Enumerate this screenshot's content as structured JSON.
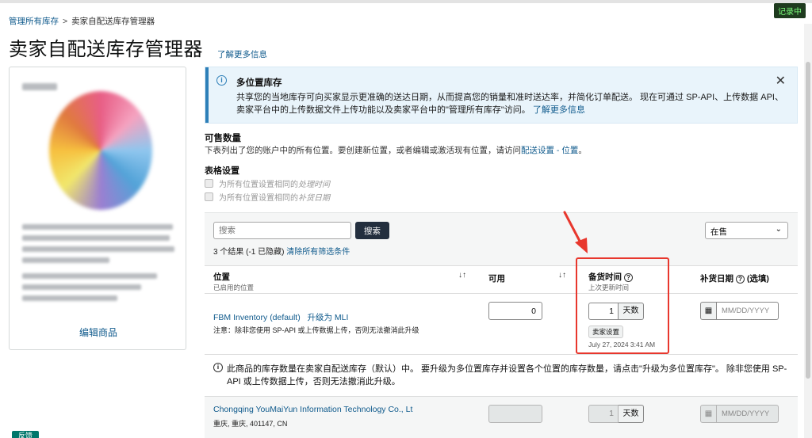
{
  "breadcrumb": {
    "root": "管理所有库存",
    "separator": ">",
    "current": "卖家自配送库存管理器"
  },
  "page": {
    "title": "卖家自配送库存管理器",
    "learn_more": "了解更多信息",
    "recording_badge": "记录中"
  },
  "product_card": {
    "edit_label": "编辑商品"
  },
  "info_box": {
    "title": "多位置库存",
    "body": "共享您的当地库存可向买家显示更准确的送达日期，从而提高您的销量和准时送达率，并简化订单配送。 现在可通过 SP-API、上传数据 API、卖家平台中的上传数据文件上传功能以及卖家平台中的\"管理所有库存\"访问。",
    "link": "了解更多信息"
  },
  "sellable": {
    "title": "可售数量",
    "desc": "下表列出了您的账户中的所有位置。要创建新位置，或者编辑或激活现有位置，请访问",
    "desc_link": "配送设置 - 位置",
    "desc_end": "。"
  },
  "table_settings": {
    "title": "表格设置",
    "opt1_prefix": "为所有位置设置相同的",
    "opt1_italic": "处理时间",
    "opt2_prefix": "为所有位置设置相同的",
    "opt2_italic": "补货日期"
  },
  "filter": {
    "search_placeholder": "搜索",
    "search_button": "搜索",
    "results": "3 个结果 (-1 已隐藏)",
    "clear_filters": "清除所有筛选条件",
    "status_value": "在售"
  },
  "table": {
    "col_location": "位置",
    "col_location_sub": "已启用的位置",
    "col_available": "可用",
    "col_handling": "备货时间",
    "col_handling_sub": "上次更新时间",
    "col_restock": "补货日期",
    "col_restock_opt": "(选填)",
    "sort_glyph": "↓↑",
    "help_glyph": "?"
  },
  "row1": {
    "location": "FBM Inventory (default)",
    "upgrade": "升级为 MLI",
    "note": "注意：除非您使用 SP-API 或上传数据上传，否则无法撤消此升级",
    "qty": "0",
    "handling_days": "1",
    "days_unit": "天数",
    "seller_tag": "卖家设置",
    "updated": "July 27, 2024 3:41 AM",
    "date_placeholder": "MM/DD/YYYY"
  },
  "notice": {
    "text": "此商品的库存数量在卖家自配送库存（默认）中。 要升级为多位置库存并设置各个位置的库存数量，请点击\"升级为多位置库存\"。 除非您使用 SP-API 或上传数据上传，否则无法撤消此升级。"
  },
  "row2": {
    "location": "Chongqing YouMaiYun Information Technology Co., Lt",
    "address": "重庆, 重庆, 401147, CN",
    "handling_days": "1",
    "days_unit": "天数",
    "date_placeholder": "MM/DD/YYYY"
  },
  "feedback_label": "反馈",
  "colors": {
    "link": "#0f5a8c",
    "info_accent": "#2d7fb8",
    "highlight": "#e8372d",
    "primary_button": "#232f3e"
  },
  "icons": {
    "info": "info-circle-icon",
    "close": "close-icon",
    "calendar": "calendar-icon",
    "chevron": "chevron-down-icon",
    "sort": "sort-icon",
    "help": "question-circle-icon"
  }
}
